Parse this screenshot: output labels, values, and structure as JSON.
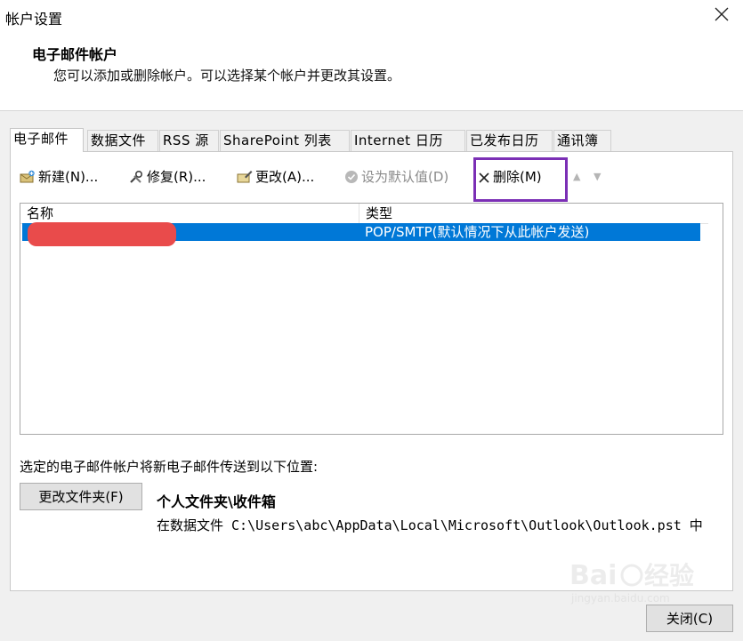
{
  "window": {
    "title": "帐户设置"
  },
  "header": {
    "title": "电子邮件帐户",
    "subtitle": "您可以添加或删除帐户。可以选择某个帐户并更改其设置。"
  },
  "tabs": [
    {
      "label": "电子邮件",
      "active": true
    },
    {
      "label": "数据文件"
    },
    {
      "label": "RSS 源"
    },
    {
      "label": "SharePoint 列表"
    },
    {
      "label": "Internet 日历"
    },
    {
      "label": "已发布日历"
    },
    {
      "label": "通讯簿"
    }
  ],
  "toolbar": {
    "new": "新建(N)...",
    "repair": "修复(R)...",
    "change": "更改(A)...",
    "set_default": "设为默认值(D)",
    "remove": "删除(M)"
  },
  "list": {
    "columns": {
      "name": "名称",
      "type": "类型"
    },
    "rows": [
      {
        "name": "",
        "type": "POP/SMTP(默认情况下从此帐户发送)"
      }
    ]
  },
  "delivery": {
    "label": "选定的电子邮件帐户将新电子邮件传送到以下位置:",
    "change_folder_button": "更改文件夹(F)",
    "folder": "个人文件夹\\收件箱",
    "path": "在数据文件 C:\\Users\\abc\\AppData\\Local\\Microsoft\\Outlook\\Outlook.pst 中"
  },
  "footer": {
    "close_button": "关闭(C)"
  },
  "colors": {
    "selection": "#0078d7",
    "highlight_box": "#7b2fb5",
    "redaction": "#e94b4b"
  }
}
